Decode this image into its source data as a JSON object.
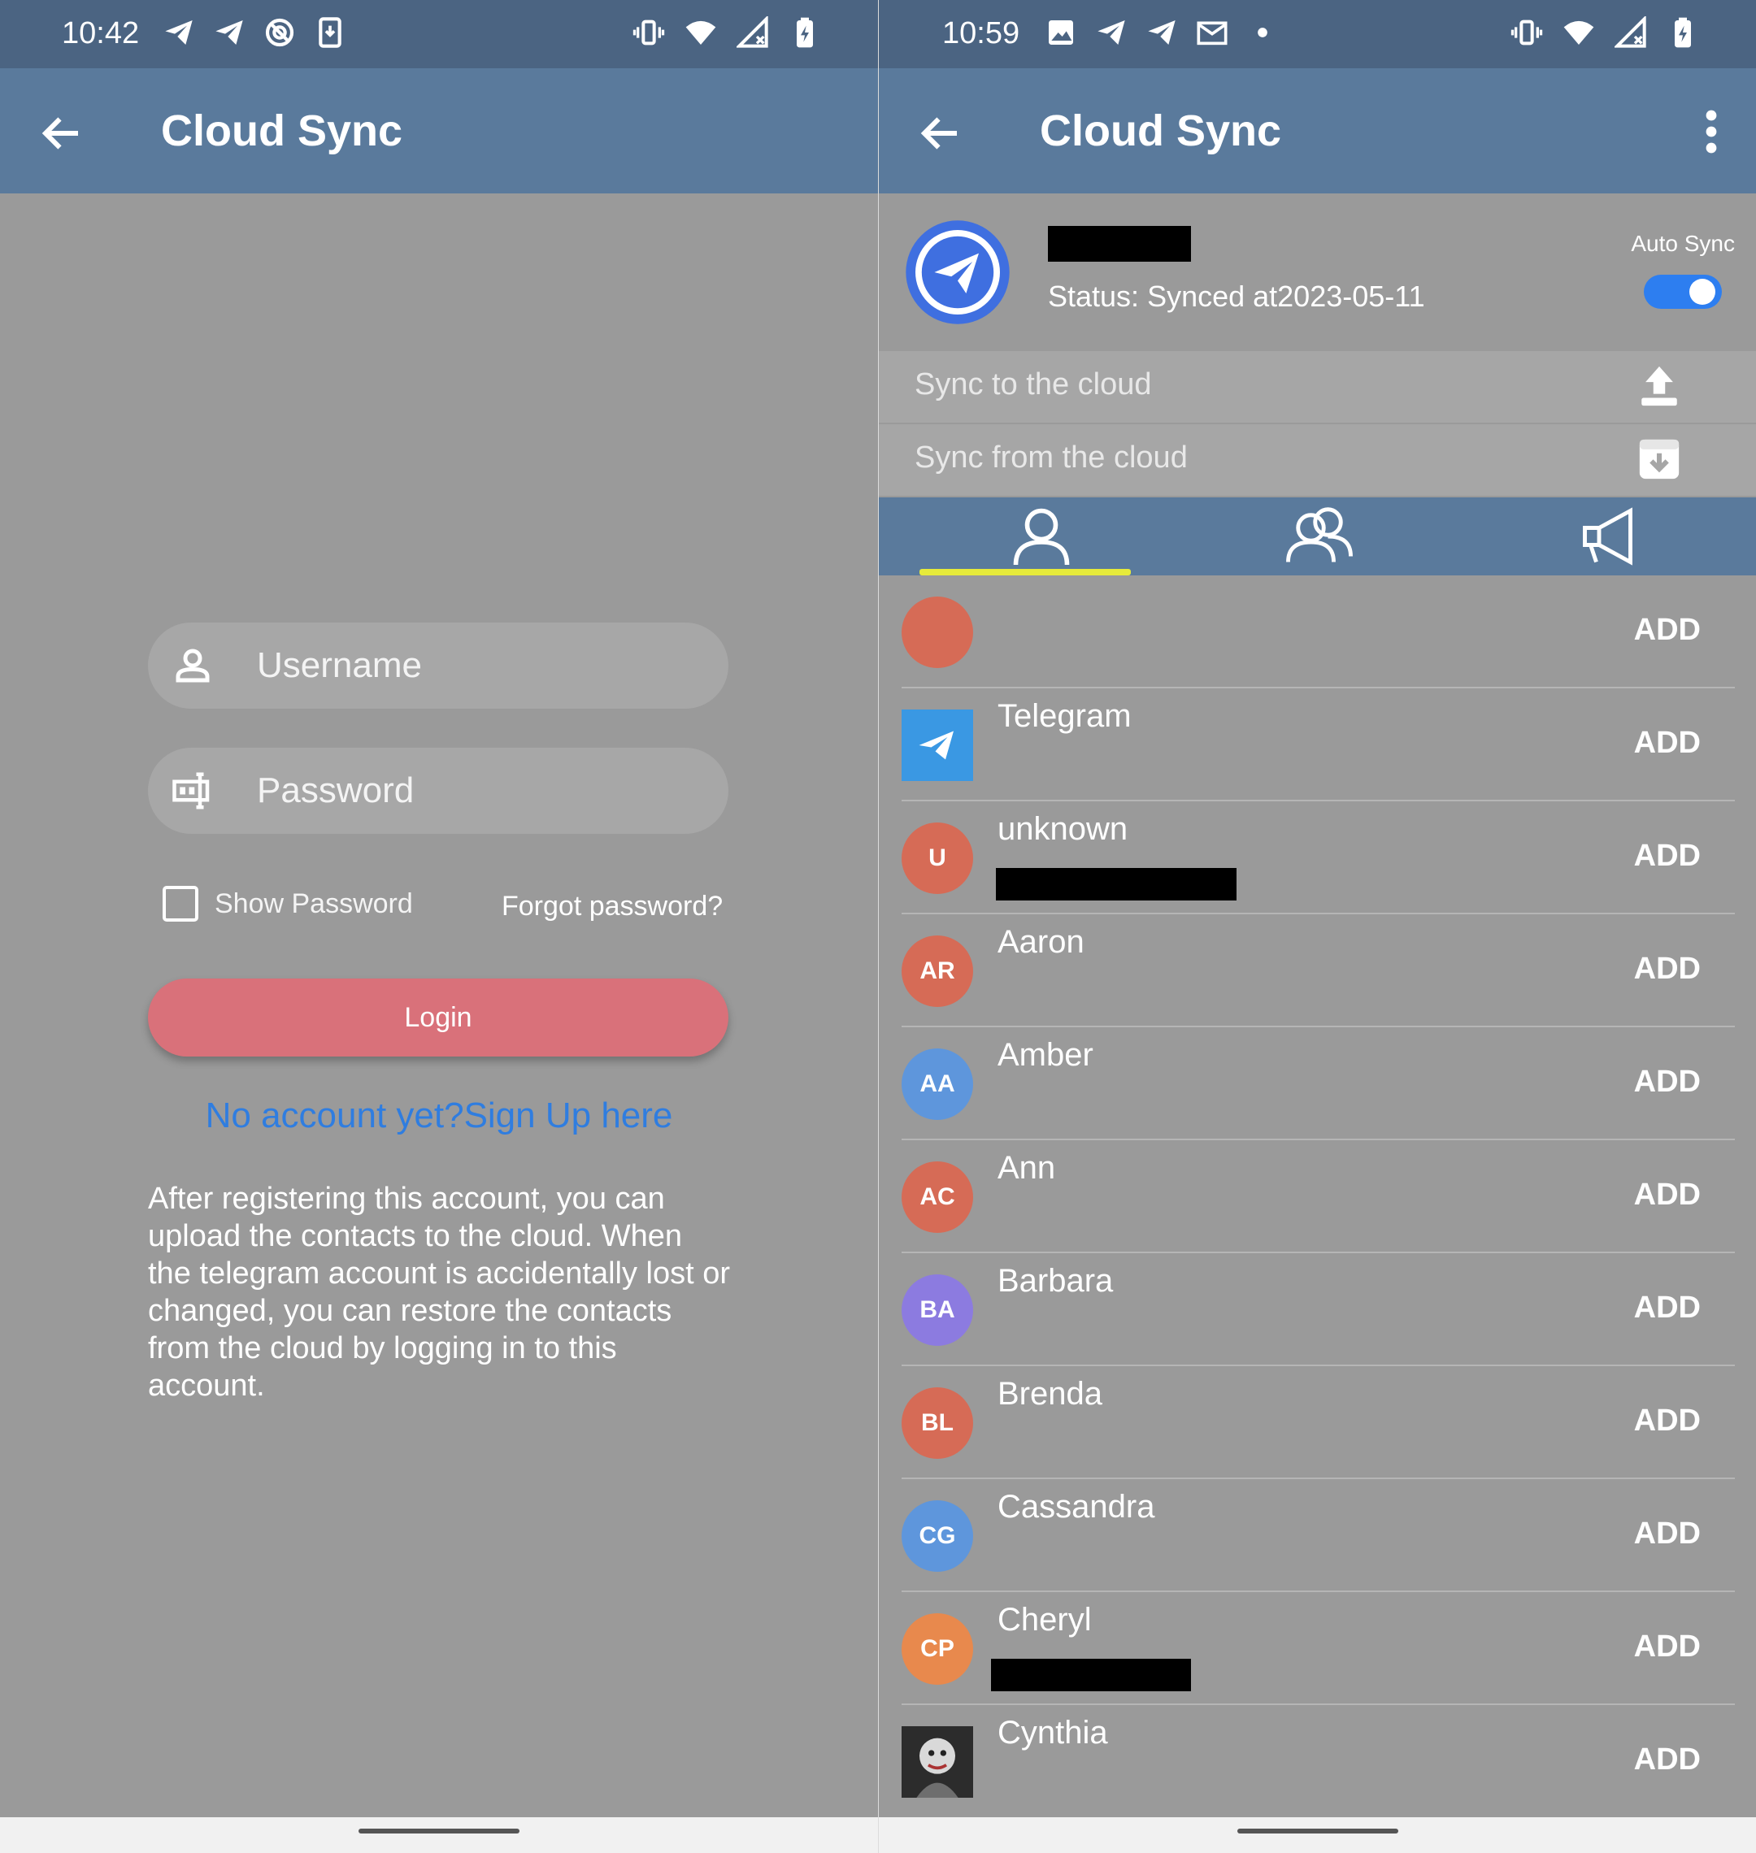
{
  "left": {
    "status": {
      "time": "10:42"
    },
    "appbar": {
      "title": "Cloud Sync"
    },
    "login": {
      "username_placeholder": "Username",
      "password_placeholder": "Password",
      "show_password": "Show Password",
      "forgot": "Forgot password?",
      "login_label": "Login",
      "signup": "No account yet?Sign Up here",
      "info": "After registering this account, you can upload the contacts to the cloud. When the telegram account is accidentally lost or changed, you can restore the contacts from the cloud by logging in to this account."
    },
    "colors": {
      "accent": "#d9717a",
      "link": "#2f7de0",
      "appbar": "#5a7a9c"
    }
  },
  "right": {
    "status": {
      "time": "10:59"
    },
    "appbar": {
      "title": "Cloud Sync"
    },
    "account": {
      "status": "Status: Synced at2023-05-11",
      "auto_sync_label": "Auto Sync",
      "auto_sync_on": true
    },
    "sync_to": "Sync to the cloud",
    "sync_from": "Sync from the cloud",
    "tabs": [
      {
        "name": "contacts",
        "icon": "person-icon",
        "selected": true
      },
      {
        "name": "groups",
        "icon": "group-icon",
        "selected": false
      },
      {
        "name": "channels",
        "icon": "megaphone-icon",
        "selected": false
      }
    ],
    "contacts": [
      {
        "name": "",
        "initials": "",
        "color": "#d66b56",
        "action": "ADD"
      },
      {
        "name": "Telegram",
        "initials": "",
        "color": "#3a98e3",
        "action": "ADD"
      },
      {
        "name": "unknown",
        "initials": "U",
        "color": "#d66b56",
        "action": "ADD"
      },
      {
        "name": "Aaron",
        "initials": "AR",
        "color": "#d66b56",
        "action": "ADD"
      },
      {
        "name": "Amber",
        "initials": "AA",
        "color": "#5e96dc",
        "action": "ADD"
      },
      {
        "name": "Ann",
        "initials": "AC",
        "color": "#d66b56",
        "action": "ADD"
      },
      {
        "name": "Barbara",
        "initials": "BA",
        "color": "#8c7be0",
        "action": "ADD"
      },
      {
        "name": "Brenda",
        "initials": "BL",
        "color": "#d66b56",
        "action": "ADD"
      },
      {
        "name": "Cassandra",
        "initials": "CG",
        "color": "#5e96dc",
        "action": "ADD"
      },
      {
        "name": "Cheryl",
        "initials": "CP",
        "color": "#e8894d",
        "action": "ADD"
      },
      {
        "name": "Cynthia",
        "initials": "",
        "color": "#3a3a3a",
        "action": "ADD"
      }
    ]
  }
}
